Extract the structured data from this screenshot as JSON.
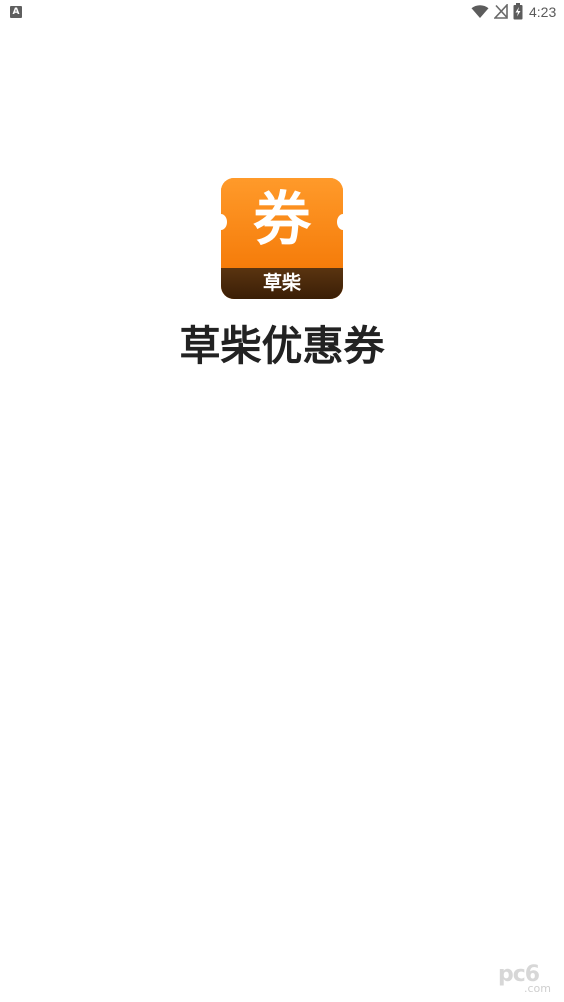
{
  "status_bar": {
    "notification_icon": "A",
    "time": "4:23",
    "icons": [
      "wifi-icon",
      "no-sim-icon",
      "battery-charging-icon"
    ]
  },
  "splash": {
    "logo_main_char": "券",
    "logo_sub_text": "草柴",
    "app_name": "草柴优惠券",
    "colors": {
      "logo_orange": "#ff8a14",
      "logo_brown": "#3a1e06",
      "title": "#222222"
    }
  },
  "watermark": {
    "text": "pc6",
    "sub": ".com"
  }
}
